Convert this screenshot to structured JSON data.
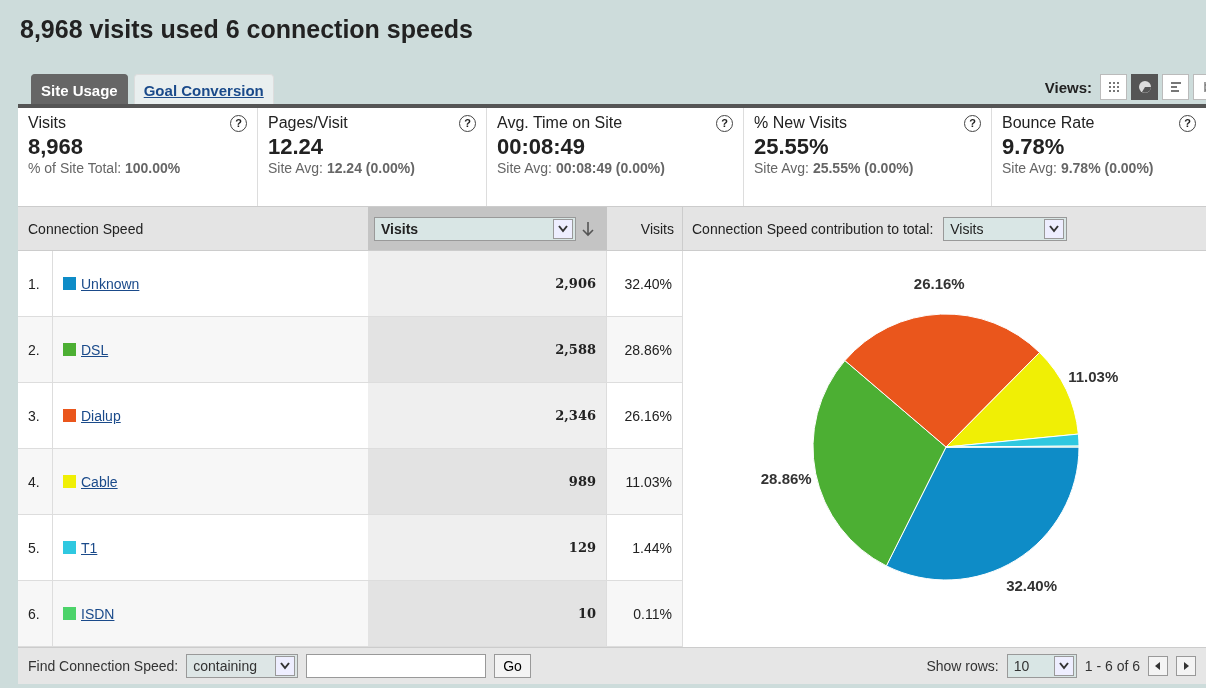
{
  "title": "8,968 visits used 6 connection speeds",
  "tabs": [
    {
      "label": "Site Usage",
      "selected": true
    },
    {
      "label": "Goal Conversion",
      "selected": false
    }
  ],
  "views": {
    "label": "Views:",
    "buttons": [
      {
        "kind": "table",
        "selected": false
      },
      {
        "kind": "pie",
        "selected": true
      },
      {
        "kind": "bar",
        "selected": false
      },
      {
        "kind": "pivot",
        "selected": false
      }
    ]
  },
  "metrics": [
    {
      "label": "Visits",
      "help": "?",
      "value": "8,968",
      "sub": "% of Site Total: **100.00%**"
    },
    {
      "label": "Pages/Visit",
      "help": "?",
      "value": "12.24",
      "sub": "Site Avg: **12.24 (0.00%)**"
    },
    {
      "label": "Avg. Time on Site",
      "help": "?",
      "value": "00:08:49",
      "sub": "Site Avg: **00:08:49 (0.00%)**"
    },
    {
      "label": "% New Visits",
      "help": "?",
      "value": "25.55%",
      "sub": "Site Avg: **25.55% (0.00%)**"
    },
    {
      "label": "Bounce Rate",
      "help": "?",
      "value": "9.78%",
      "sub": "Site Avg: **9.78% (0.00%)**"
    }
  ],
  "table": {
    "columns": {
      "name": "Connection Speed",
      "sort_select": "Visits",
      "percent": "Visits",
      "contribution_label": "Connection Speed contribution to total:",
      "contribution_select": "Visits"
    },
    "rows": [
      {
        "rank": "1.",
        "name": "Unknown",
        "color": "#0e8cc7",
        "visits": "2,906",
        "percent": "32.40%"
      },
      {
        "rank": "2.",
        "name": "DSL",
        "color": "#4caf33",
        "visits": "2,588",
        "percent": "28.86%"
      },
      {
        "rank": "3.",
        "name": "Dialup",
        "color": "#ea561c",
        "visits": "2,346",
        "percent": "26.16%"
      },
      {
        "rank": "4.",
        "name": "Cable",
        "color": "#f0ef05",
        "visits": "989",
        "percent": "11.03%"
      },
      {
        "rank": "5.",
        "name": "T1",
        "color": "#2fc8e0",
        "visits": "129",
        "percent": "1.44%"
      },
      {
        "rank": "6.",
        "name": "ISDN",
        "color": "#4cd36a",
        "visits": "10",
        "percent": "0.11%"
      }
    ]
  },
  "chart_data": {
    "type": "pie",
    "values": [
      32.4,
      28.86,
      26.16,
      11.03,
      1.44,
      0.11
    ],
    "colors": [
      "#0e8cc7",
      "#4caf33",
      "#ea561c",
      "#f0ef05",
      "#2fc8e0",
      "#4cd36a"
    ],
    "value_labels": [
      "32.40%",
      "28.86%",
      "26.16%",
      "11.03%",
      null,
      null
    ]
  },
  "footer": {
    "find_label": "Find Connection Speed:",
    "match_select": "containing",
    "go": "Go",
    "show_rows_label": "Show rows:",
    "rows_select": "10",
    "range": "1 - 6 of 6"
  }
}
